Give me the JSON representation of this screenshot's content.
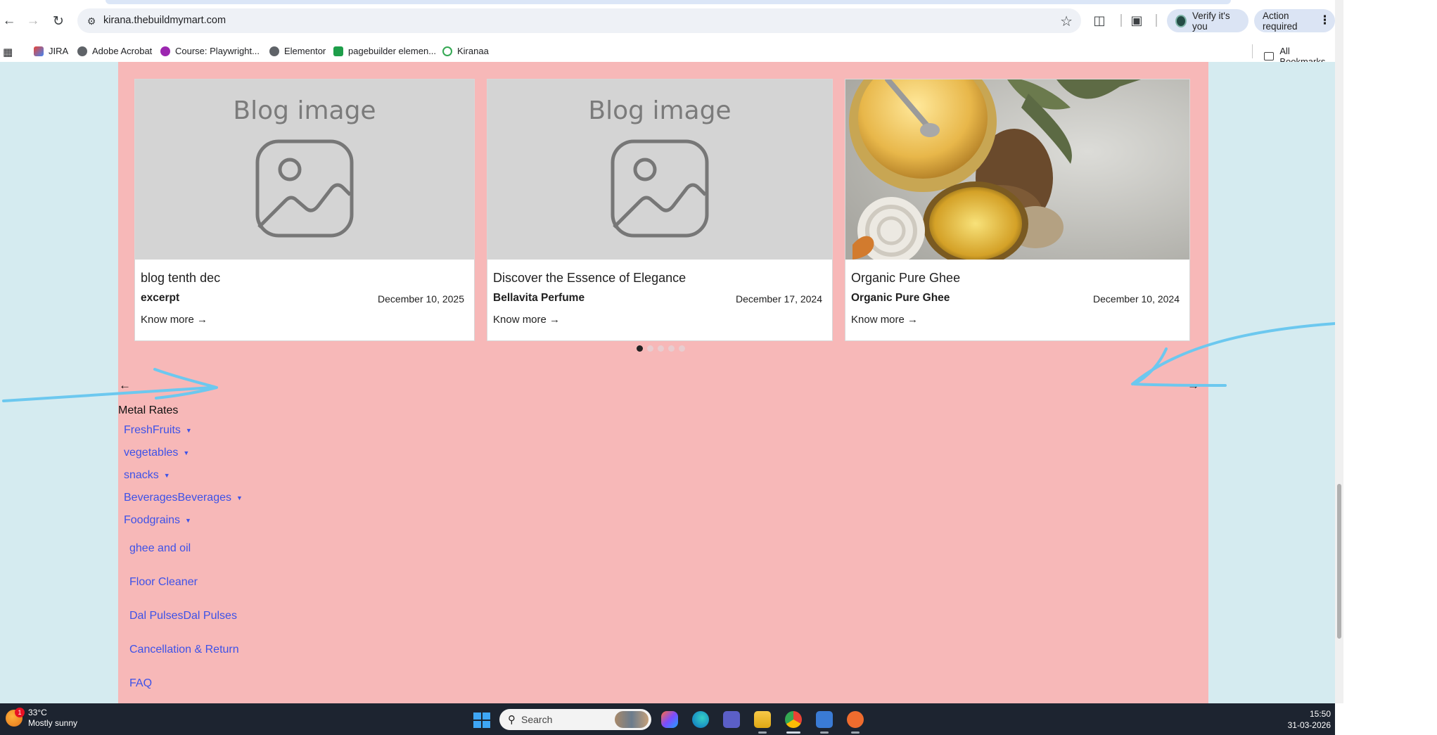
{
  "browser": {
    "url": "kirana.thebuildmymart.com",
    "verify_label": "Verify it's you",
    "action_label": "Action required",
    "bookmarks": [
      "JIRA",
      "Adobe Acrobat",
      "Course: Playwright...",
      "Elementor",
      "pagebuilder elemen...",
      "Kiranaa"
    ],
    "all_bookmarks": "All Bookmarks"
  },
  "blog": {
    "placeholder_text": "Blog image",
    "cards": [
      {
        "title": "blog tenth dec",
        "excerpt": "excerpt",
        "date": "December 10, 2025",
        "more": "Know more →"
      },
      {
        "title": "Discover the Essence of Elegance",
        "excerpt": "Bellavita Perfume",
        "date": "December 17, 2024",
        "more": "Know more →"
      },
      {
        "title": "Organic Pure Ghee",
        "excerpt": "Organic Pure Ghee",
        "date": "December 10, 2024",
        "more": "Know more →"
      }
    ],
    "dots_active": 1
  },
  "nav": {
    "prev_arrow": "←",
    "next_arrow": "→",
    "metal_rates": "Metal Rates",
    "menu": [
      {
        "label": "FreshFruits"
      },
      {
        "label": "vegetables"
      },
      {
        "label": "snacks"
      },
      {
        "label": "BeveragesBeverages"
      },
      {
        "label": "Foodgrains"
      }
    ],
    "links": [
      "ghee and oil",
      "Floor Cleaner",
      "Dal PulsesDal Pulses",
      "Cancellation & Return",
      "FAQ"
    ]
  },
  "taskbar": {
    "temp": "33°C",
    "condition": "Mostly sunny",
    "weather_badge": "1",
    "search_placeholder": "Search",
    "time": "15:50",
    "date": "31-03-2026"
  },
  "colors": {
    "page_bg": "#f7b8b8",
    "outer_bg": "#d5ebf0",
    "link": "#3d52e8",
    "annotation": "#6cc8ef"
  }
}
